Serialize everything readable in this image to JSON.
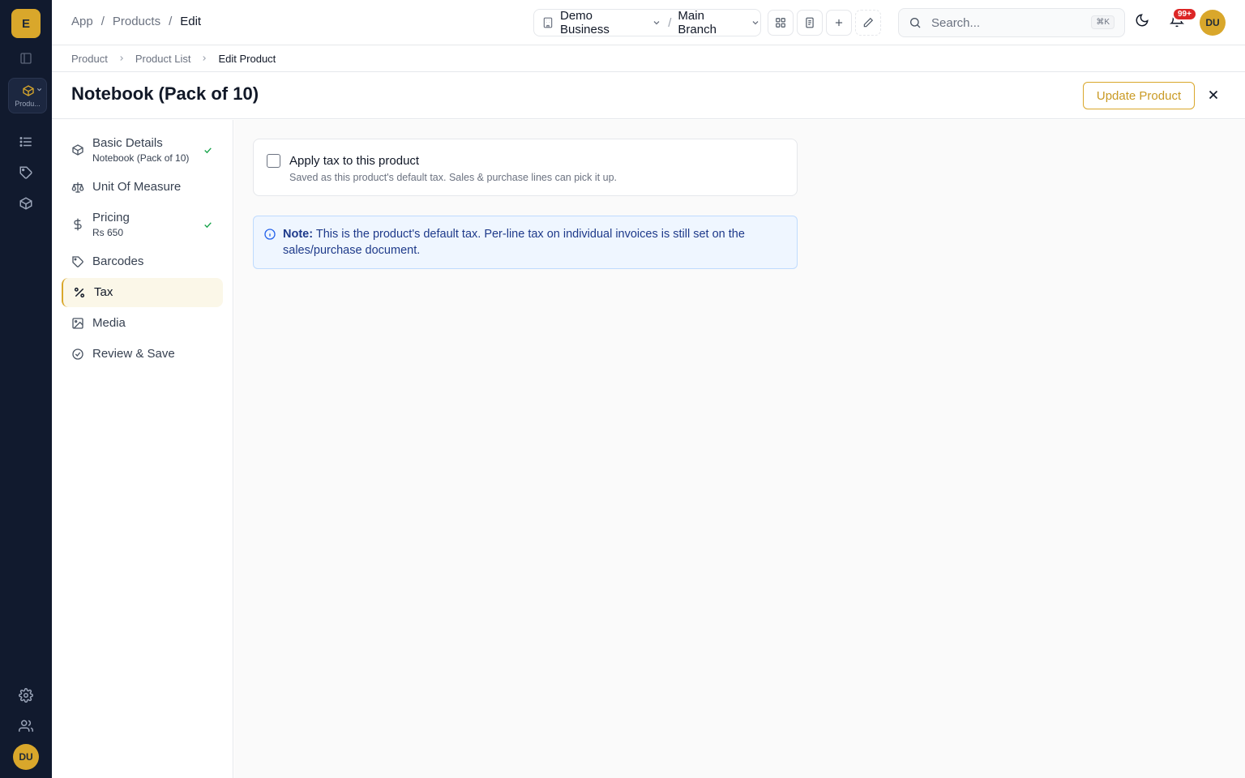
{
  "rail": {
    "logo_letter": "E",
    "module_label": "Produ...",
    "user_initials": "DU"
  },
  "topbar": {
    "breadcrumb": [
      "App",
      "Products",
      "Edit"
    ],
    "business": "Demo Business",
    "branch": "Main Branch",
    "search_placeholder": "Search...",
    "search_shortcut": "⌘K",
    "notifications_badge": "99+",
    "user_initials": "DU"
  },
  "subcrumb": [
    "Product",
    "Product List",
    "Edit Product"
  ],
  "page": {
    "title": "Notebook (Pack of 10)",
    "update_label": "Update Product"
  },
  "steps": [
    {
      "label": "Basic Details",
      "sub": "Notebook (Pack of 10)",
      "done": true
    },
    {
      "label": "Unit Of Measure",
      "sub": "",
      "done": false
    },
    {
      "label": "Pricing",
      "sub": "Rs 650",
      "done": true
    },
    {
      "label": "Barcodes",
      "sub": "",
      "done": false
    },
    {
      "label": "Tax",
      "sub": "",
      "done": false,
      "active": true
    },
    {
      "label": "Media",
      "sub": "",
      "done": false
    },
    {
      "label": "Review & Save",
      "sub": "",
      "done": false
    }
  ],
  "tax": {
    "checkbox_label": "Apply tax to this product",
    "checkbox_checked": false,
    "checkbox_help": "Saved as this product's default tax. Sales & purchase lines can pick it up.",
    "note_title": "Note:",
    "note_text": "This is the product's default tax. Per-line tax on individual invoices is still set on the sales/purchase document."
  },
  "colors": {
    "accent": "#d9a72b",
    "rail_bg": "#111a2e",
    "success": "#16a34a",
    "info": "#2563eb"
  }
}
